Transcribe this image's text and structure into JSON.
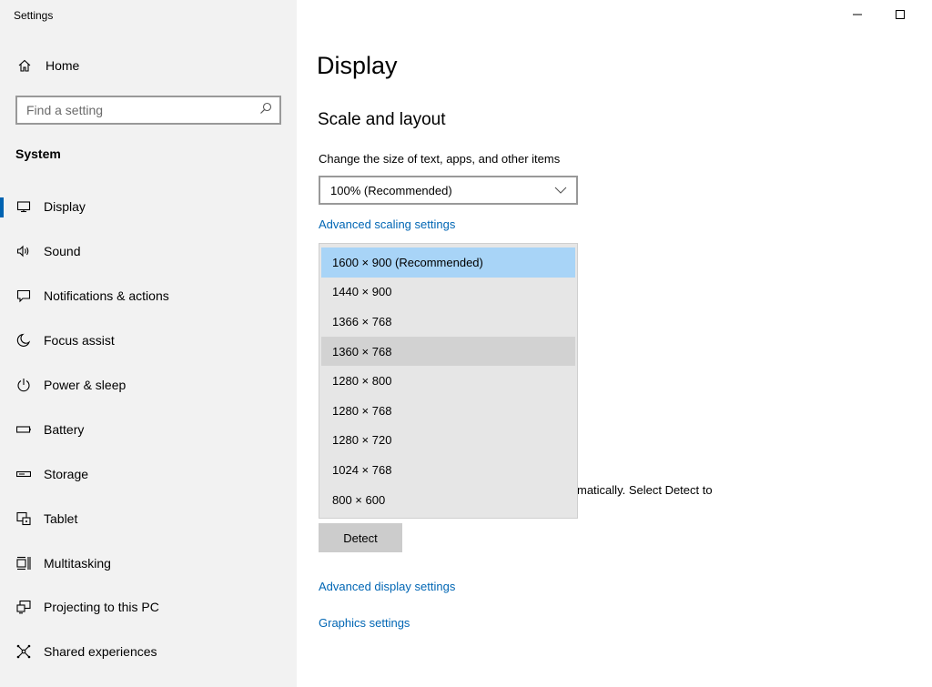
{
  "window": {
    "title": "Settings"
  },
  "sidebar": {
    "home_label": "Home",
    "search_placeholder": "Find a setting",
    "section_label": "System",
    "items": [
      {
        "label": "Display",
        "icon": "monitor-icon",
        "selected": true
      },
      {
        "label": "Sound",
        "icon": "speaker-icon"
      },
      {
        "label": "Notifications & actions",
        "icon": "notification-icon"
      },
      {
        "label": "Focus assist",
        "icon": "moon-icon"
      },
      {
        "label": "Power & sleep",
        "icon": "power-icon"
      },
      {
        "label": "Battery",
        "icon": "battery-icon"
      },
      {
        "label": "Storage",
        "icon": "storage-icon"
      },
      {
        "label": "Tablet",
        "icon": "tablet-icon"
      },
      {
        "label": "Multitasking",
        "icon": "multitasking-icon"
      },
      {
        "label": "Projecting to this PC",
        "icon": "projecting-icon"
      },
      {
        "label": "Shared experiences",
        "icon": "shared-experiences-icon"
      }
    ]
  },
  "main": {
    "title": "Display",
    "section_heading": "Scale and layout",
    "scale_label": "Change the size of text, apps, and other items",
    "scale_value": "100% (Recommended)",
    "advanced_scaling_link": "Advanced scaling settings",
    "partial_text": "matically. Select Detect to",
    "detect_button": "Detect",
    "advanced_display_link": "Advanced display settings",
    "graphics_link": "Graphics settings"
  },
  "resolution_dropdown": {
    "options": [
      "1600 × 900 (Recommended)",
      "1440 × 900",
      "1366 × 768",
      "1360 × 768",
      "1280 × 800",
      "1280 × 768",
      "1280 × 720",
      "1024 × 768",
      "800 × 600"
    ],
    "selected_index": 0,
    "hover_index": 3
  },
  "colors": {
    "accent": "#0063b1",
    "link": "#0066b4",
    "selected_option": "#a8d4f7",
    "hover_option": "#d2d2d2"
  }
}
